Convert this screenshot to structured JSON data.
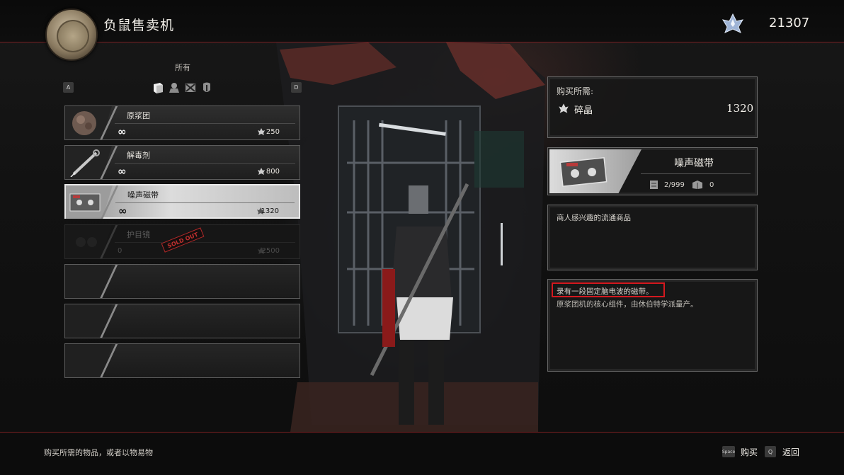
{
  "header": {
    "title": "负鼠售卖机",
    "currency": "21307",
    "currency_icon": "haze-crystal-icon"
  },
  "categories": {
    "label": "所有",
    "left_key": "A",
    "right_key": "D",
    "tab_icons": [
      "consumable-box-icon",
      "helmet-figure-icon",
      "crossed-weapons-icon",
      "mask-icon"
    ]
  },
  "items": [
    {
      "name": "原浆团",
      "qty": "∞",
      "price": "250",
      "icon": "blood-bead-icon"
    },
    {
      "name": "解毒剂",
      "qty": "∞",
      "price": "800",
      "icon": "syringe-icon"
    },
    {
      "name": "噪声磁带",
      "qty": "∞",
      "price": "1320",
      "icon": "cassette-tape-icon",
      "selected": true
    },
    {
      "name": "护目镜",
      "qty": "0",
      "price": "2500",
      "icon": "goggles-icon",
      "sold_out": true,
      "stamp": "SOLD OUT"
    }
  ],
  "cost": {
    "label": "购买所需:",
    "item_name": "碎晶",
    "value": "1320"
  },
  "detail": {
    "name": "噪声磁带",
    "owned": "2/999",
    "stored": "0",
    "category_text": "商人感兴趣的流通商品",
    "description_line1": "录有一段固定脑电波的磁带。",
    "description_line2": "原浆团机的核心组件，由休伯特学派量产。"
  },
  "footer": {
    "hint": "购买所需的物品，或者以物易物",
    "buy_key": "Space",
    "buy_label": "购买",
    "back_key": "Q",
    "back_label": "返回"
  },
  "colors": {
    "accent_red": "#7a1f22",
    "highlight_red": "#d4191f"
  }
}
